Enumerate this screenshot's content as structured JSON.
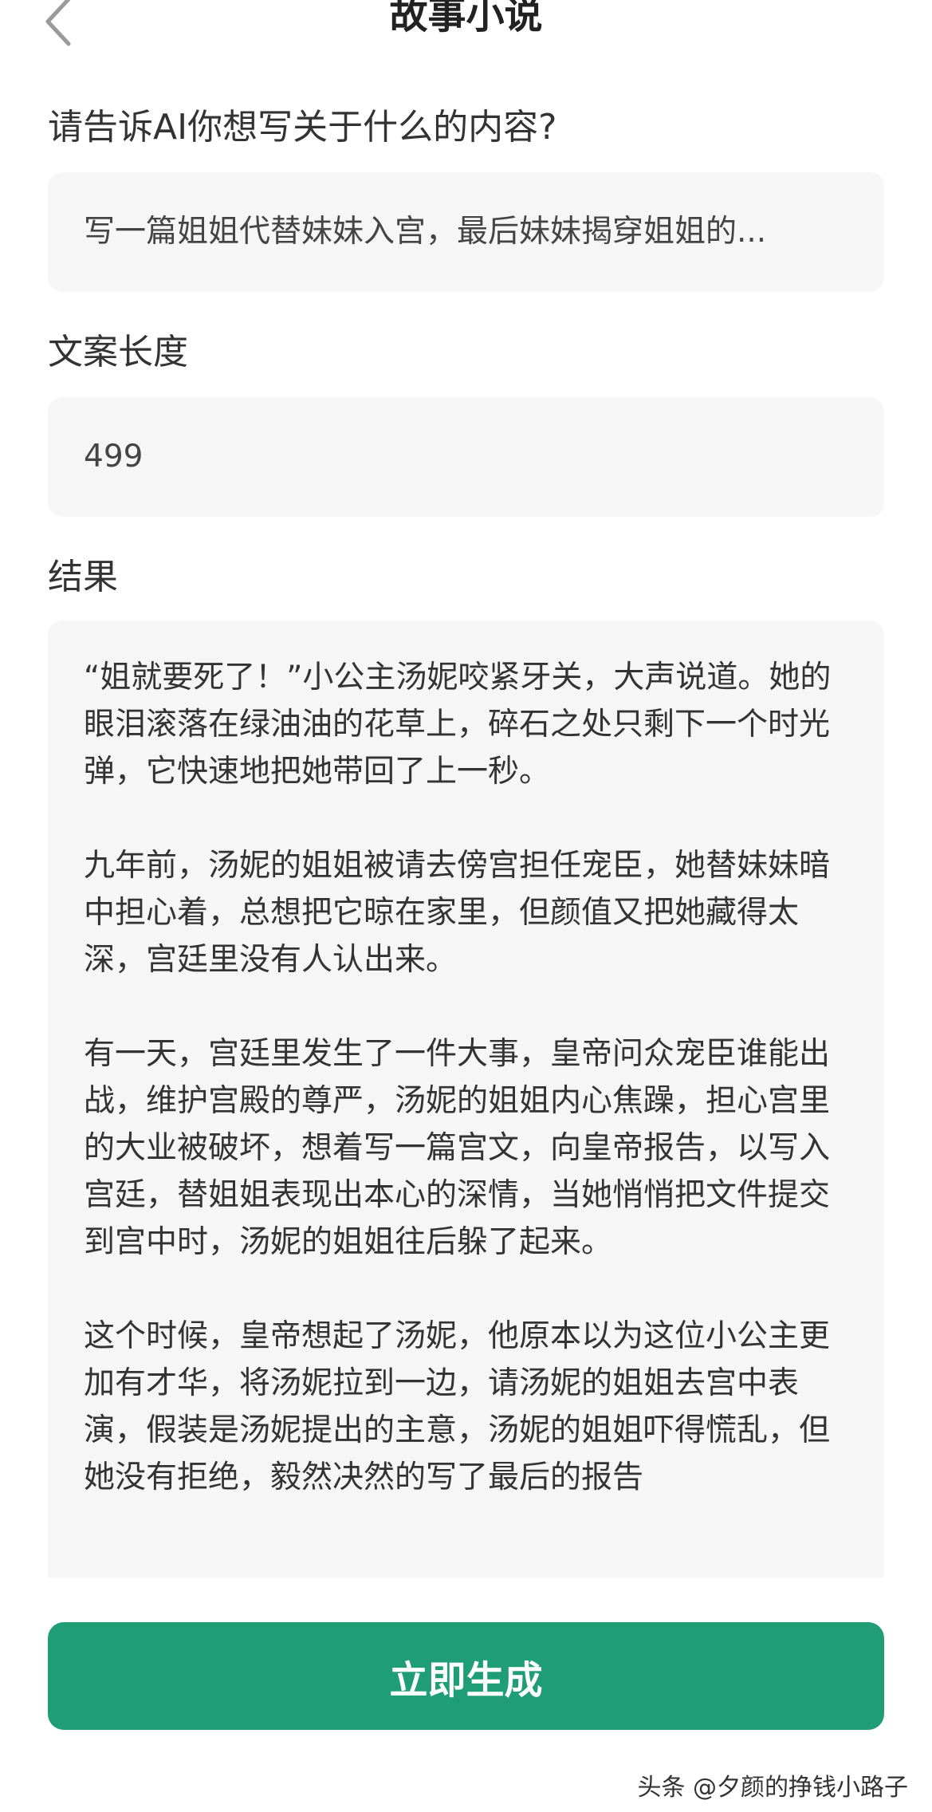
{
  "header": {
    "title": "故事小说",
    "back_icon": "chevron-left-icon"
  },
  "topic": {
    "label": "请告诉AI你想写关于什么的内容?",
    "value": "写一篇姐姐代替妹妹入宫，最后妹妹揭穿姐姐的..."
  },
  "length": {
    "label": "文案长度",
    "value": "499"
  },
  "result": {
    "label": "结果",
    "paragraphs": [
      "“姐就要死了！”小公主汤妮咬紧牙关，大声说道。她的眼泪滚落在绿油油的花草上，碎石之处只剩下一个时光弹，它快速地把她带回了上一秒。",
      "九年前，汤妮的姐姐被请去傍宫担任宠臣，她替妹妹暗中担心着，总想把它晾在家里，但颜值又把她藏得太深，宫廷里没有人认出来。",
      "有一天，宫廷里发生了一件大事，皇帝问众宠臣谁能出战，维护宫殿的尊严，汤妮的姐姐内心焦躁，担心宫里的大业被破坏，想着写一篇宫文，向皇帝报告，以写入宫廷，替姐姐表现出本心的深情，当她悄悄把文件提交到宫中时，汤妮的姐姐往后躲了起来。",
      "这个时候，皇帝想起了汤妮，他原本以为这位小公主更加有才华，将汤妮拉到一边，请汤妮的姐姐去宫中表演，假装是汤妮提出的主意，汤妮的姐姐吓得慌乱，但她没有拒绝，毅然决然的写了最后的报告"
    ]
  },
  "actions": {
    "generate_label": "立即生成"
  },
  "watermark": {
    "text": "头条 @夕颜的挣钱小路子"
  },
  "colors": {
    "accent": "#1f9d74",
    "field_bg": "#f6f6f6"
  }
}
